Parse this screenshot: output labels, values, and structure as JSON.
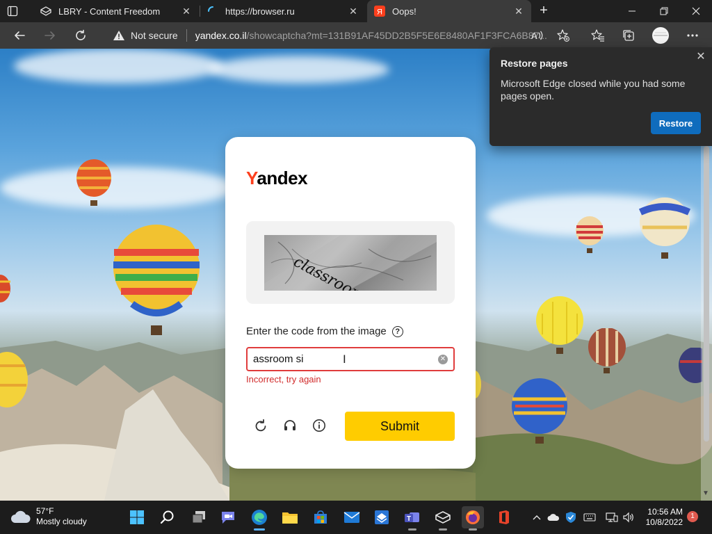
{
  "tabs": [
    {
      "title": "LBRY - Content Freedom",
      "icon": "lbry-icon",
      "active": false
    },
    {
      "title": "https://browser.ru",
      "icon": "loading-icon",
      "active": false
    },
    {
      "title": "Oops!",
      "icon": "yandex-icon",
      "active": true
    }
  ],
  "address_bar": {
    "security_label": "Not secure",
    "host": "yandex.co.il",
    "path": "/showcaptcha?mt=131B91AF45DD2B5F5E6E8480AF1F3FCA6B87..."
  },
  "card": {
    "logo_first": "Y",
    "logo_rest": "andex",
    "captcha_text": "classroom side",
    "prompt": "Enter the code from the image",
    "help_symbol": "?",
    "answer_value": "assroom si",
    "error": "Incorrect, try again",
    "submit_label": "Submit"
  },
  "popup": {
    "title": "Restore pages",
    "body": "Microsoft Edge closed while you had some pages open.",
    "button": "Restore"
  },
  "taskbar": {
    "temperature": "57°F",
    "condition": "Mostly cloudy",
    "time": "10:56 AM",
    "date": "10/8/2022",
    "notifications": "1"
  },
  "colors": {
    "yandex_red": "#fc3f1d",
    "submit_yellow": "#ffcc00",
    "error_red": "#d12b2b",
    "edge_blue": "#0f6cbd"
  }
}
